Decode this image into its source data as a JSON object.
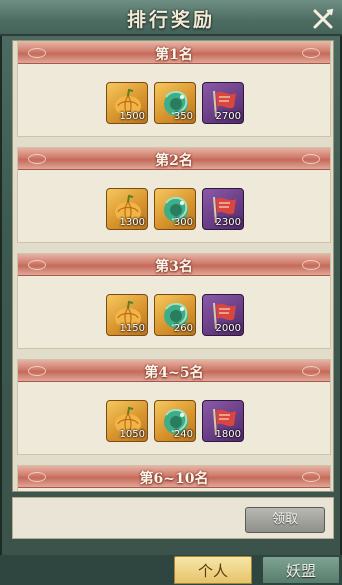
{
  "title": "排行奖励",
  "close_icon": "close-x-icon",
  "tiers": [
    {
      "label": "第1名",
      "rewards": [
        {
          "icon": "pumpkin-icon",
          "quantity": "1500",
          "frame": "gold"
        },
        {
          "icon": "jade-dragon-icon",
          "quantity": "350",
          "frame": "gold"
        },
        {
          "icon": "red-banner-icon",
          "quantity": "2700",
          "frame": "purple"
        }
      ]
    },
    {
      "label": "第2名",
      "rewards": [
        {
          "icon": "pumpkin-icon",
          "quantity": "1300",
          "frame": "gold"
        },
        {
          "icon": "jade-dragon-icon",
          "quantity": "300",
          "frame": "gold"
        },
        {
          "icon": "red-banner-icon",
          "quantity": "2300",
          "frame": "purple"
        }
      ]
    },
    {
      "label": "第3名",
      "rewards": [
        {
          "icon": "pumpkin-icon",
          "quantity": "1150",
          "frame": "gold"
        },
        {
          "icon": "jade-dragon-icon",
          "quantity": "260",
          "frame": "gold"
        },
        {
          "icon": "red-banner-icon",
          "quantity": "2000",
          "frame": "purple"
        }
      ]
    },
    {
      "label": "第4~5名",
      "rewards": [
        {
          "icon": "pumpkin-icon",
          "quantity": "1050",
          "frame": "gold"
        },
        {
          "icon": "jade-dragon-icon",
          "quantity": "240",
          "frame": "gold"
        },
        {
          "icon": "red-banner-icon",
          "quantity": "1800",
          "frame": "purple"
        }
      ]
    },
    {
      "label": "第6~10名",
      "rewards": []
    }
  ],
  "claim_button": "领取",
  "tabs": {
    "personal": "个人",
    "alliance": "妖盟"
  },
  "colors": {
    "header_bg": "#4e6d62",
    "tier_banner": "#c46a5a",
    "gold_frame": "#d9962e",
    "purple_frame": "#6b3f88",
    "active_tab": "#e5c46a"
  }
}
